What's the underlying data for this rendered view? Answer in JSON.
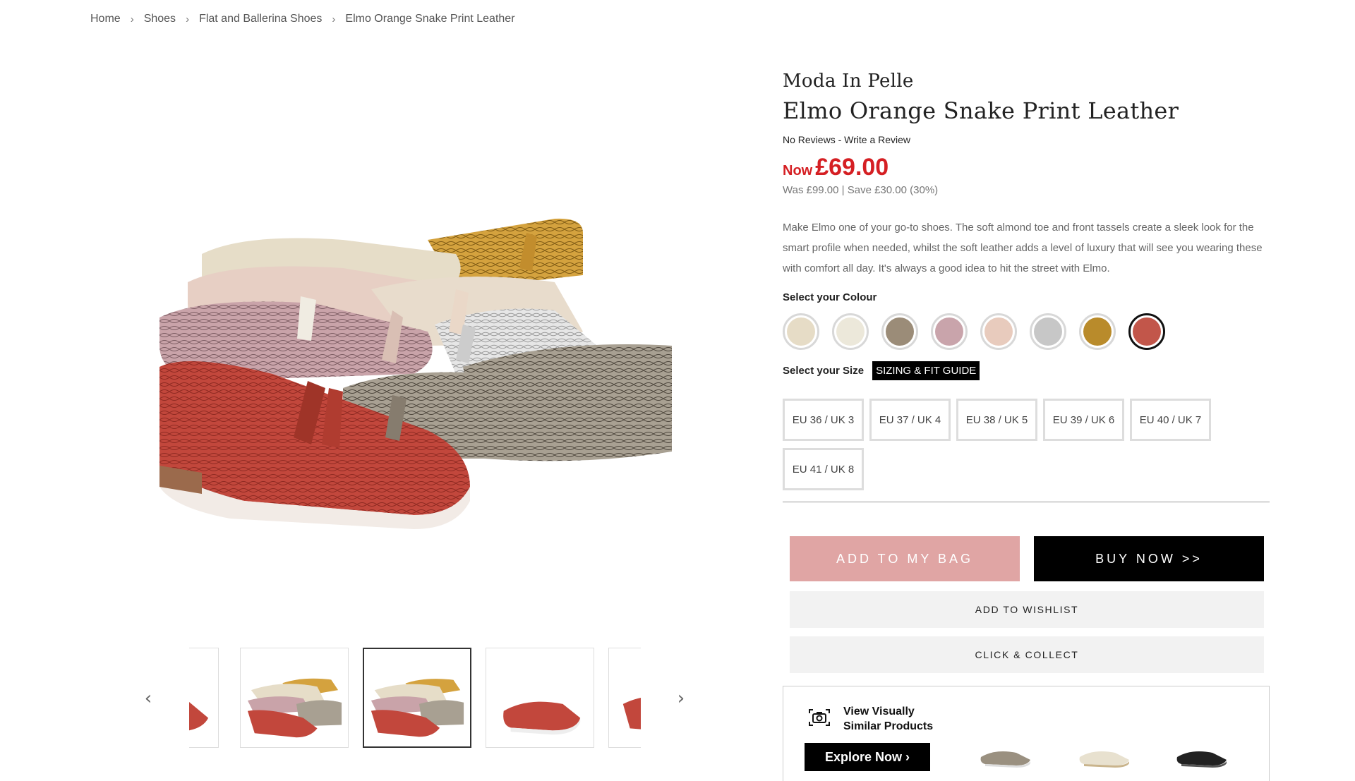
{
  "breadcrumb": {
    "items": [
      "Home",
      "Shoes",
      "Flat and Ballerina Shoes",
      "Elmo Orange Snake Print Leather"
    ],
    "separator": "›"
  },
  "gallery": {
    "prev_icon": "‹",
    "next_icon": "›"
  },
  "product": {
    "brand": "Moda In Pelle",
    "title": "Elmo Orange Snake Print Leather",
    "reviews_text": "No Reviews",
    "reviews_sep": " - ",
    "write_review": "Write a Review",
    "now_label": "Now",
    "now_price": "£69.00",
    "was_text": "Was £99.00",
    "was_sep": " | ",
    "save_text": "Save £30.00 (30%)",
    "description": "Make Elmo one of your go-to shoes. The soft almond toe and front tassels create a sleek look for the smart profile when needed, whilst the soft leather adds a level of luxury that will see you wearing these with comfort all day. It's always a good idea to hit the street with Elmo.",
    "price_color": "#d51f23"
  },
  "colour": {
    "label": "Select your Colour",
    "swatches": [
      {
        "name": "cream",
        "color": "#e6dcc6",
        "selected": false
      },
      {
        "name": "white-snake",
        "color": "#ece8da",
        "selected": false
      },
      {
        "name": "taupe-snake",
        "color": "#9b8c78",
        "selected": false
      },
      {
        "name": "pink-snake",
        "color": "#c9a4ab",
        "selected": false
      },
      {
        "name": "blush",
        "color": "#e8cbbd",
        "selected": false
      },
      {
        "name": "silver-snake",
        "color": "#c7c7c7",
        "selected": false
      },
      {
        "name": "mustard-snake",
        "color": "#b98b2b",
        "selected": false
      },
      {
        "name": "orange-snake",
        "color": "#c2564a",
        "selected": true
      }
    ]
  },
  "size": {
    "label": "Select your Size",
    "guide_label": "SIZING & FIT GUIDE",
    "options": [
      "EU 36 / UK 3",
      "EU 37 / UK 4",
      "EU 38 / UK 5",
      "EU 39 / UK 6",
      "EU 40 / UK 7",
      "EU 41 / UK 8"
    ]
  },
  "actions": {
    "add_to_bag": "ADD TO MY BAG",
    "buy_now": "BUY NOW >>",
    "add_to_wishlist": "ADD TO WISHLIST",
    "click_collect": "CLICK & COLLECT",
    "add_color": "#e0a5a4",
    "buy_color": "#000000"
  },
  "visual_search": {
    "title": "View Visually Similar Products",
    "explore_label": "Explore Now ›",
    "icon": "camera-icon"
  }
}
